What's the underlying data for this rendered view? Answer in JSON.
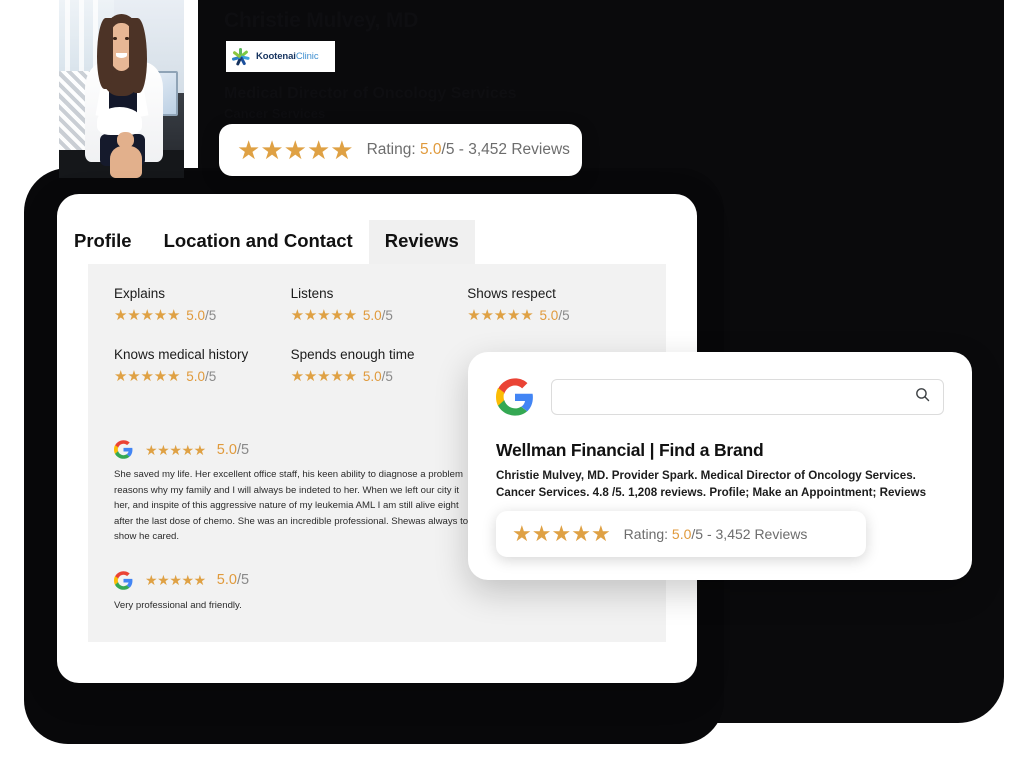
{
  "brand": {
    "clinic_name_bold": "Kootenai",
    "clinic_name_light": "Clinic",
    "doctor_name": "Christie Mulvey, MD",
    "doctor_role": "Medical Director of Oncology Services",
    "doctor_dept": "Cancer Services"
  },
  "top_rating_pill": {
    "label_prefix": "Rating: ",
    "score": "5.0",
    "out_of": "/5 - ",
    "review_count": "3,452 Reviews",
    "stars": 5,
    "star_color": "#dfa144"
  },
  "profile_card": {
    "tabs": [
      {
        "label": "Profile",
        "active": false
      },
      {
        "label": "Location and Contact",
        "active": false
      },
      {
        "label": "Reviews",
        "active": true
      }
    ],
    "metrics": [
      {
        "label": "Explains",
        "score": "5.0",
        "out_of": "/5",
        "stars": 5
      },
      {
        "label": "Listens",
        "score": "5.0",
        "out_of": "/5",
        "stars": 5
      },
      {
        "label": "Shows respect",
        "score": "5.0",
        "out_of": "/5",
        "stars": 5
      },
      {
        "label": "Knows medical history",
        "score": "5.0",
        "out_of": "/5",
        "stars": 5
      },
      {
        "label": "Spends enough time",
        "score": "5.0",
        "out_of": "/5",
        "stars": 5
      }
    ],
    "reviews": [
      {
        "source": "Google",
        "score": "5.0",
        "out_of": "/5",
        "stars": 5,
        "text": "She saved my life. Her excellent office staff, his keen ability to diagnose a problem reasons why my family and I will always be indeted to her. When we left our city it her, and inspite of this aggressive nature of my leukemia AML I am still alive eight after the last dose of chemo. She was an incredible professional. Shewas always to show he cared."
      },
      {
        "source": "Google",
        "score": "5.0",
        "out_of": "/5",
        "stars": 5,
        "text": "Very professional and friendly."
      }
    ]
  },
  "google_card": {
    "search_value": "",
    "search_placeholder": "",
    "result_title": "Wellman Financial | Find a Brand",
    "result_description": "Christie Mulvey, MD. Provider Spark. Medical Director of Oncology Services. Cancer Services. 4.8 /5. 1,208 reviews. Profile; Make an Appointment; Reviews",
    "rating_pill": {
      "label_prefix": "Rating: ",
      "score": "5.0",
      "out_of": "/5 - ",
      "review_count": "3,452 Reviews",
      "stars": 5
    }
  }
}
